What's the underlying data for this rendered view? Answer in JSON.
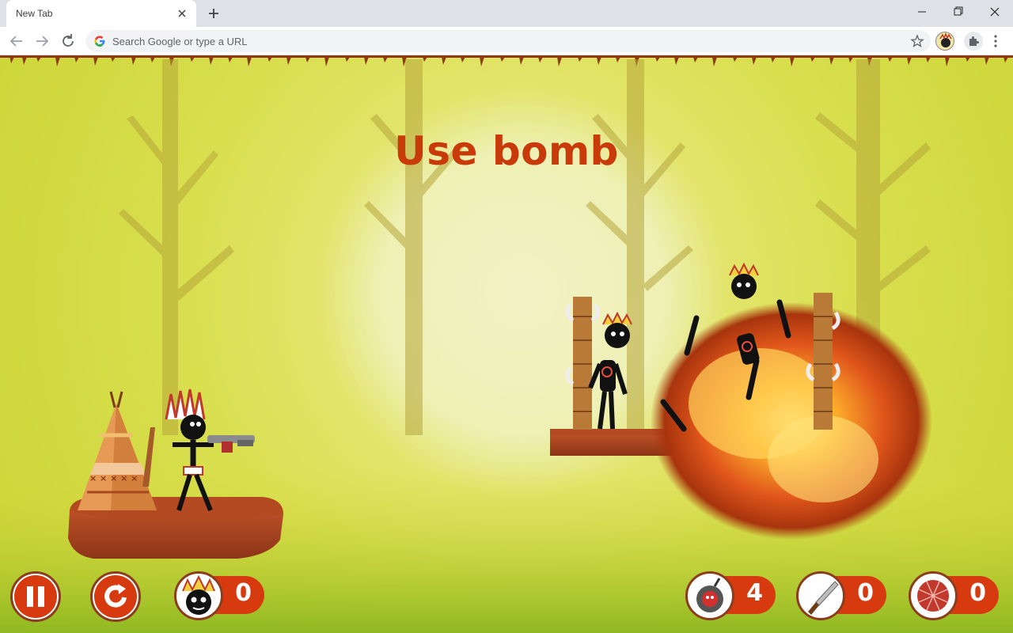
{
  "browser": {
    "tab_title": "New Tab",
    "omnibox_placeholder": "Search Google or type a URL"
  },
  "game": {
    "message": "Use bomb",
    "player_kills": "0",
    "inventory": {
      "bombs": "4",
      "knives": "0",
      "nets": "0"
    }
  },
  "colors": {
    "accent": "#d83a10",
    "title": "#c83a09",
    "sky": "#d9df4f"
  }
}
